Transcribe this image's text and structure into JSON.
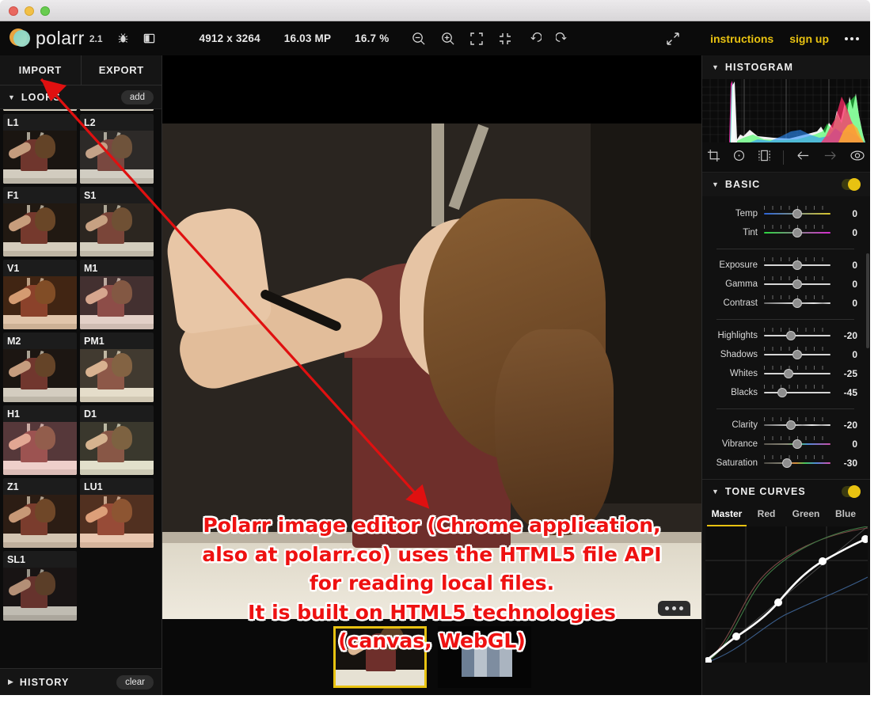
{
  "window": {
    "controls": [
      "close",
      "minimize",
      "maximize"
    ]
  },
  "toolbar": {
    "brand": "polarr",
    "version": "2.1",
    "bug_icon": "bug-icon",
    "panel_icon": "panel-toggle-icon",
    "dimensions": "4912 x 3264",
    "megapixels": "16.03 MP",
    "zoom_level": "16.7 %",
    "zoom_out_icon": "zoom-out-icon",
    "zoom_in_icon": "zoom-in-icon",
    "fit_icon": "fit-screen-icon",
    "actual_icon": "collapse-icon",
    "undo_icon": "undo-icon",
    "redo_icon": "redo-icon",
    "fullscreen_icon": "fullscreen-icon",
    "instructions_label": "instructions",
    "signup_label": "sign up",
    "more_icon": "more-icon",
    "accent": "#e8c211"
  },
  "left_panel": {
    "import_label": "IMPORT",
    "export_label": "EXPORT",
    "looks_title": "LOOKS",
    "add_label": "add",
    "history_title": "HISTORY",
    "clear_label": "clear",
    "looks": [
      {
        "name": "",
        "tint": "rgba(0,0,0,0)",
        "partial": true
      },
      {
        "name": "",
        "tint": "rgba(0,0,0,0)",
        "partial": true
      },
      {
        "name": "L1",
        "tint": "rgba(20,10,0,0.10)"
      },
      {
        "name": "L2",
        "tint": "rgba(120,120,120,0.20)"
      },
      {
        "name": "F1",
        "tint": "rgba(80,40,10,0.12)"
      },
      {
        "name": "S1",
        "tint": "rgba(120,110,90,0.18)"
      },
      {
        "name": "V1",
        "tint": "rgba(200,90,20,0.22)"
      },
      {
        "name": "M1",
        "tint": "rgba(210,140,150,0.22)"
      },
      {
        "name": "M2",
        "tint": "rgba(40,20,10,0.10)"
      },
      {
        "name": "PM1",
        "tint": "rgba(220,200,160,0.20)"
      },
      {
        "name": "H1",
        "tint": "rgba(255,150,170,0.26)"
      },
      {
        "name": "D1",
        "tint": "rgba(200,210,160,0.18)"
      },
      {
        "name": "Z1",
        "tint": "rgba(120,60,20,0.18)"
      },
      {
        "name": "LU1",
        "tint": "rgba(235,120,70,0.26)"
      },
      {
        "name": "SL1",
        "tint": "rgba(10,10,20,0.18)"
      }
    ]
  },
  "right_panel": {
    "histogram_title": "HISTOGRAM",
    "tools": [
      "crop-icon",
      "radial-mask-icon",
      "linear-mask-icon",
      "back-arrow-icon",
      "forward-arrow-icon",
      "eye-icon"
    ],
    "basic_title": "BASIC",
    "basic_enabled": true,
    "sliders": [
      {
        "label": "Temp",
        "value": "0",
        "pos": 50,
        "style": "temp"
      },
      {
        "label": "Tint",
        "value": "0",
        "pos": 50,
        "style": "tint"
      },
      {
        "label": "Exposure",
        "value": "0",
        "pos": 50,
        "style": "plain"
      },
      {
        "label": "Gamma",
        "value": "0",
        "pos": 50,
        "style": "plain"
      },
      {
        "label": "Contrast",
        "value": "0",
        "pos": 50,
        "style": "contrast"
      },
      {
        "label": "Highlights",
        "value": "-20",
        "pos": 40,
        "style": "plain"
      },
      {
        "label": "Shadows",
        "value": "0",
        "pos": 50,
        "style": "plain"
      },
      {
        "label": "Whites",
        "value": "-25",
        "pos": 37,
        "style": "plain"
      },
      {
        "label": "Blacks",
        "value": "-45",
        "pos": 27,
        "style": "plain"
      },
      {
        "label": "Clarity",
        "value": "-20",
        "pos": 40,
        "style": "clarity"
      },
      {
        "label": "Vibrance",
        "value": "0",
        "pos": 50,
        "style": "vib"
      },
      {
        "label": "Saturation",
        "value": "-30",
        "pos": 35,
        "style": "sat"
      }
    ],
    "tone_curves_title": "TONE CURVES",
    "tone_curves_enabled": true,
    "curve_tabs": [
      {
        "label": "Master",
        "active": true
      },
      {
        "label": "Red",
        "active": false
      },
      {
        "label": "Green",
        "active": false
      },
      {
        "label": "Blue",
        "active": false
      }
    ]
  },
  "canvas": {
    "filmstrip_menu_icon": "more-icon",
    "thumbnails": [
      {
        "selected": true
      },
      {
        "selected": false
      }
    ]
  },
  "annotations": {
    "arrow_color": "#e01010",
    "text_lines": [
      "Polarr image editor (Chrome application,",
      "also at polarr.co) uses the HTML5 file API",
      "for reading local files.",
      "It is built on HTML5 technologies",
      "(canvas, WebGL)"
    ]
  }
}
